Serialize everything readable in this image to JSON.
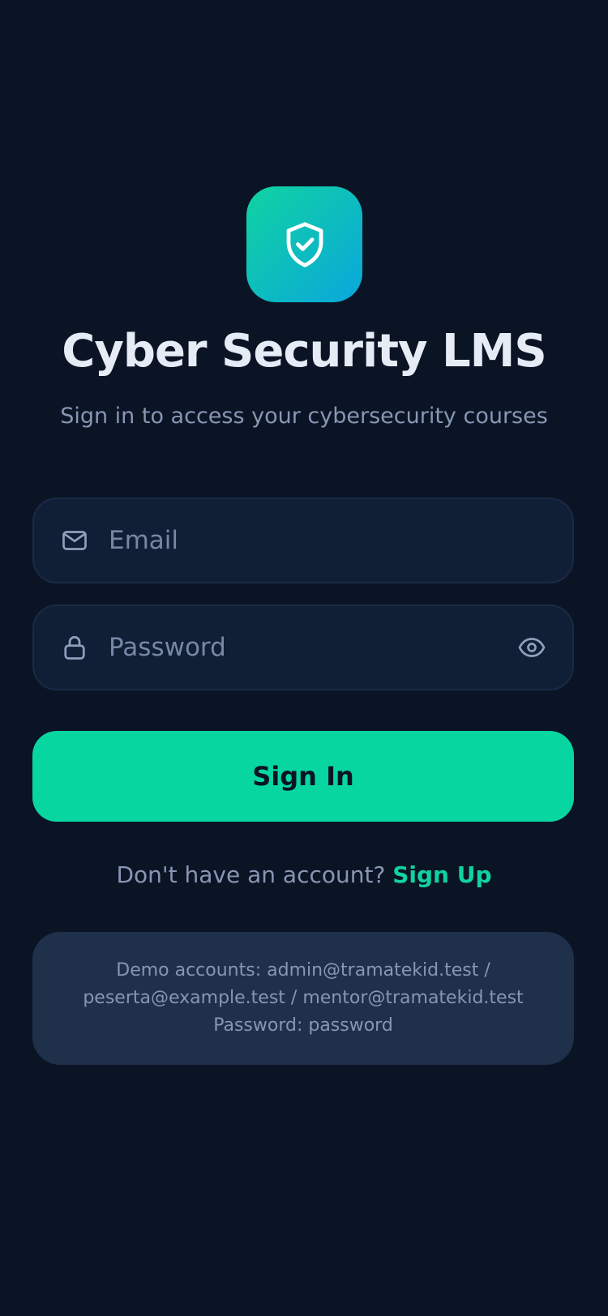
{
  "app": {
    "title": "Cyber Security LMS",
    "subtitle": "Sign in to access your cybersecurity courses",
    "logo_icon": "shield-check-icon"
  },
  "form": {
    "email": {
      "placeholder": "Email",
      "value": "",
      "icon": "mail-icon"
    },
    "password": {
      "placeholder": "Password",
      "value": "",
      "icon": "lock-icon",
      "toggle_icon": "eye-icon"
    },
    "submit_label": "Sign In"
  },
  "signup": {
    "prompt": "Don't have an account?",
    "link_label": "Sign Up"
  },
  "demo": {
    "line1": "Demo accounts: admin@tramatekid.test /",
    "line2": "peserta@example.test / mentor@tramatekid.test",
    "line3": "Password: password"
  },
  "colors": {
    "background": "#0b1425",
    "accent": "#07d6a0",
    "field_bg": "#101e36",
    "demo_bg": "#1f304b",
    "text_primary": "#e6ecf6",
    "text_secondary": "#8796b3"
  }
}
